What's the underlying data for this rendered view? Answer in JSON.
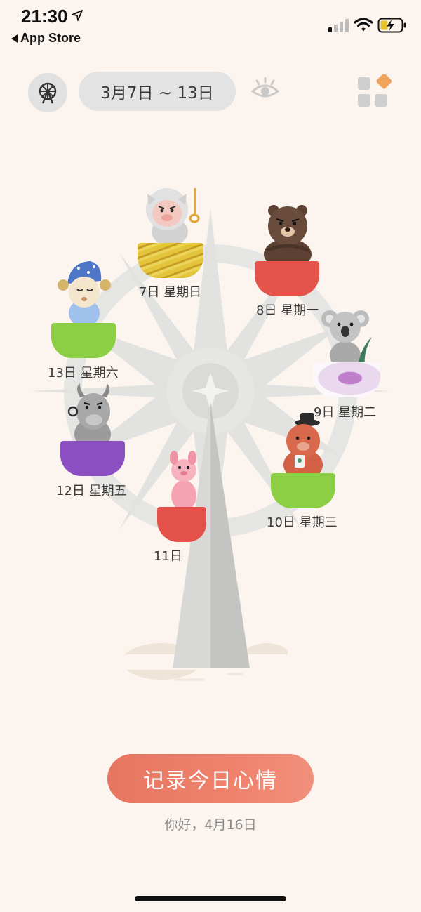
{
  "status_bar": {
    "time": "21:30",
    "back_label": "App Store"
  },
  "header": {
    "date_range": "3月7日 ~ 13日",
    "icons": [
      "ferris-wheel-icon",
      "eye-icon",
      "grid-icon"
    ]
  },
  "wheel": {
    "cars": [
      {
        "label": "7日 星期日",
        "animal": "pig-astronaut",
        "color": "#e2c233"
      },
      {
        "label": "8日 星期一",
        "animal": "bear",
        "color": "#e4544a"
      },
      {
        "label": "9日 星期二",
        "animal": "koala",
        "color": "#e8d8ee"
      },
      {
        "label": "10日 星期三",
        "animal": "bear-hat",
        "color": "#8ccf45"
      },
      {
        "label": "11日",
        "animal": "pink-dog",
        "color": "#e4504a"
      },
      {
        "label": "12日 星期五",
        "animal": "ox",
        "color": "#8b4fc1"
      },
      {
        "label": "13日 星期六",
        "animal": "sheep-sleepy",
        "color": "#8ccf45"
      }
    ]
  },
  "main": {
    "record_button": "记录今日心情",
    "greeting": "你好，4月16日"
  }
}
